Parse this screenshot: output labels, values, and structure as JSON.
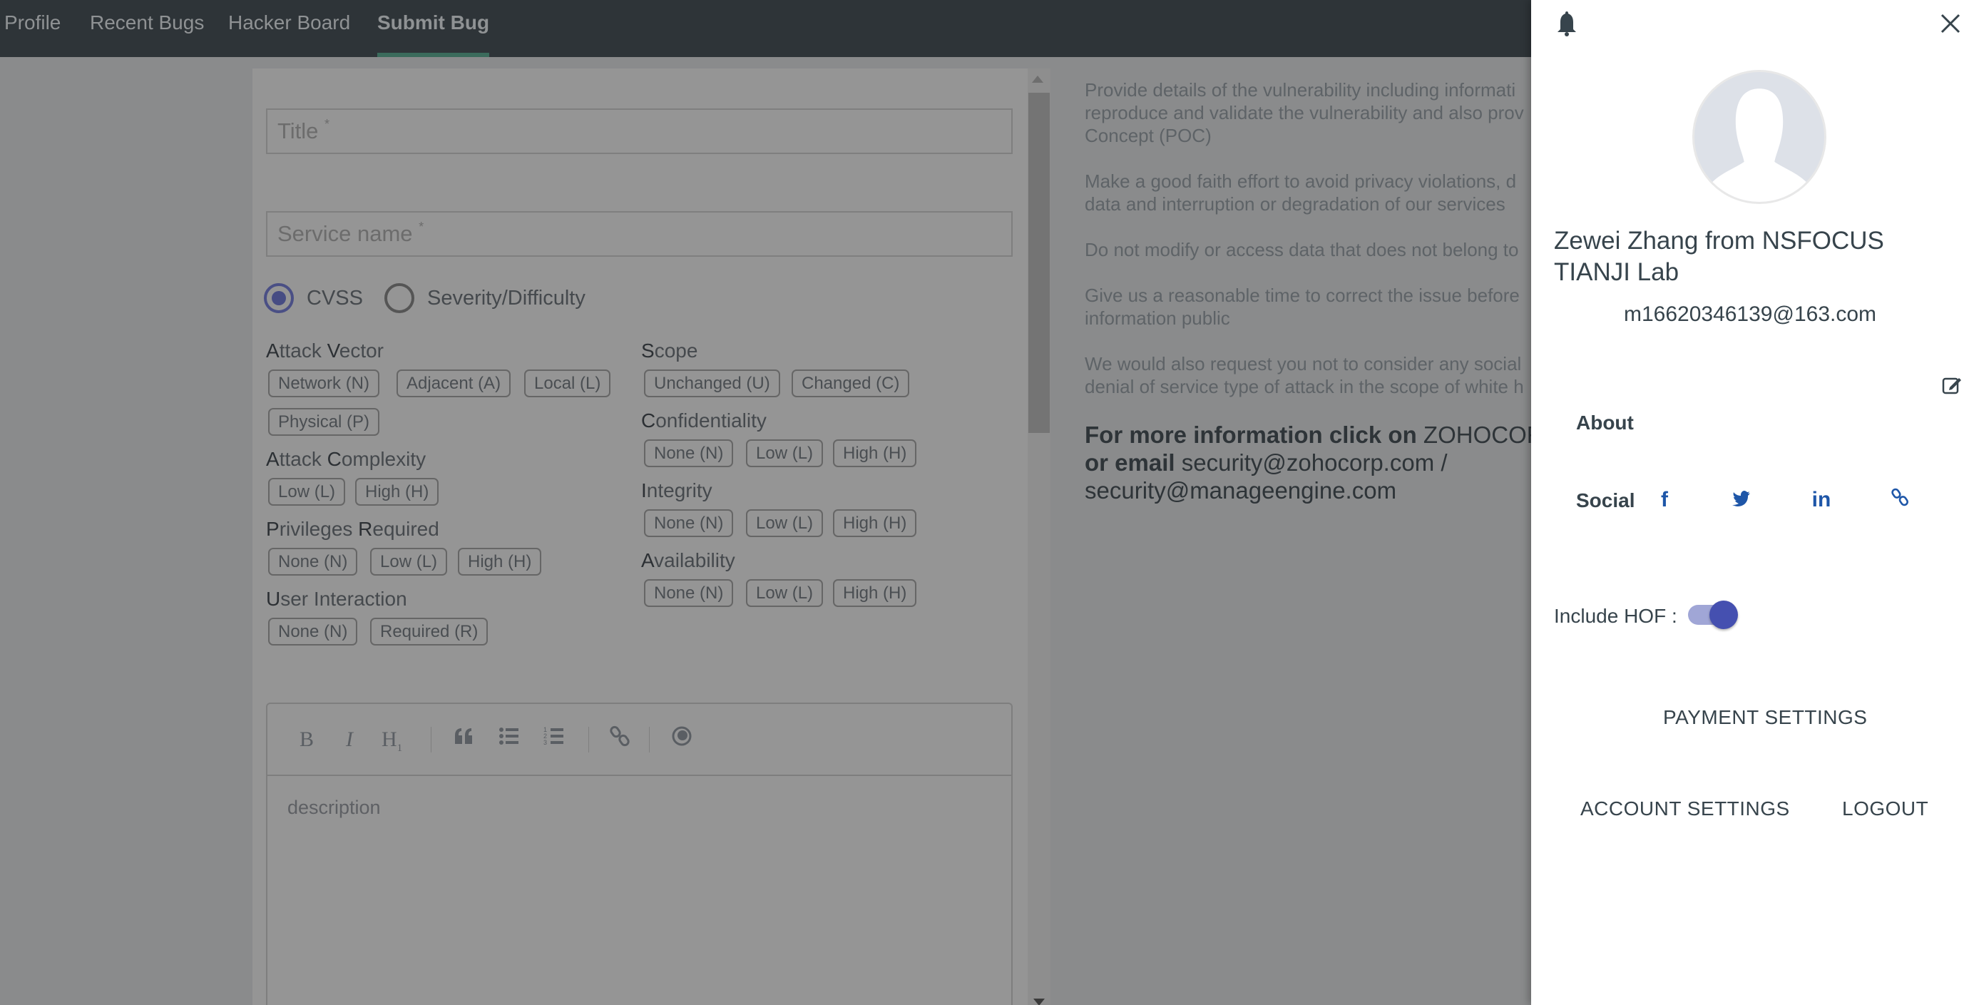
{
  "nav": {
    "tabs": [
      {
        "label": "Profile",
        "active": false
      },
      {
        "label": "Recent Bugs",
        "active": false
      },
      {
        "label": "Hacker Board",
        "active": false
      },
      {
        "label": "Submit Bug",
        "active": true
      }
    ]
  },
  "form": {
    "title_placeholder": "Title",
    "service_placeholder": "Service name",
    "required_mark": "*",
    "scoring": {
      "options": [
        "CVSS",
        "Severity/Difficulty"
      ],
      "selected": "CVSS"
    },
    "cvss": {
      "attack_vector": {
        "label_first": "A",
        "label_mid": "ttack ",
        "label_first2": "V",
        "label_rest": "ector",
        "options": [
          "Network (N)",
          "Adjacent (A)",
          "Local (L)",
          "Physical (P)"
        ]
      },
      "attack_complexity": {
        "label_first": "A",
        "label_mid": "ttack ",
        "label_first2": "C",
        "label_rest": "omplexity",
        "options": [
          "Low (L)",
          "High (H)"
        ]
      },
      "privileges_required": {
        "label_first": "P",
        "label_mid": "rivileges ",
        "label_first2": "R",
        "label_rest": "equired",
        "options": [
          "None (N)",
          "Low (L)",
          "High (H)"
        ]
      },
      "user_interaction": {
        "label_first": "U",
        "label_mid": "ser Interaction",
        "options": [
          "None (N)",
          "Required (R)"
        ]
      },
      "scope": {
        "label_first": "S",
        "label_mid": "cope",
        "options": [
          "Unchanged (U)",
          "Changed (C)"
        ]
      },
      "confidentiality": {
        "label_first": "C",
        "label_mid": "onfidentiality",
        "options": [
          "None (N)",
          "Low (L)",
          "High (H)"
        ]
      },
      "integrity": {
        "label_first": "I",
        "label_mid": "ntegrity",
        "options": [
          "None (N)",
          "Low (L)",
          "High (H)"
        ]
      },
      "availability": {
        "label_first": "A",
        "label_mid": "vailability",
        "options": [
          "None (N)",
          "Low (L)",
          "High (H)"
        ]
      }
    },
    "editor": {
      "toolbar": {
        "bold": "B",
        "italic": "I",
        "heading": "H",
        "heading_sub": "1"
      },
      "placeholder": "description"
    }
  },
  "info": {
    "paragraphs": [
      "Provide details of the vulnerability including informati",
      "reproduce and validate the vulnerability and also prov",
      "Concept (POC)",
      "Make a good faith effort to avoid privacy violations, d",
      "data and interruption or degradation of our services",
      "Do not modify or access data that does not belong to",
      "Give us a reasonable time to correct the issue before",
      "information public",
      "We would also request you not to consider any social",
      "denial of service type of attack in the scope of white h"
    ],
    "more_prefix": "For more information click on",
    "more_link": "ZOHOCORP",
    "email_prefix": "or email",
    "email_1": "security@zohocorp.com /",
    "email_2": "security@manageengine.com"
  },
  "drawer": {
    "user_name": "Zewei Zhang from NSFOCUS TIANJI Lab",
    "email": "m16620346139@163.com",
    "about_label": "About",
    "social_label": "Social",
    "social_icons": [
      "facebook-icon",
      "twitter-icon",
      "linkedin-icon",
      "link-icon"
    ],
    "include_hof_label": "Include HOF :",
    "include_hof_on": true,
    "payment_settings": "PAYMENT SETTINGS",
    "account_settings": "ACCOUNT SETTINGS",
    "logout": "LOGOUT",
    "accent_color": "#4550b0",
    "social_color": "#1e56a8"
  }
}
